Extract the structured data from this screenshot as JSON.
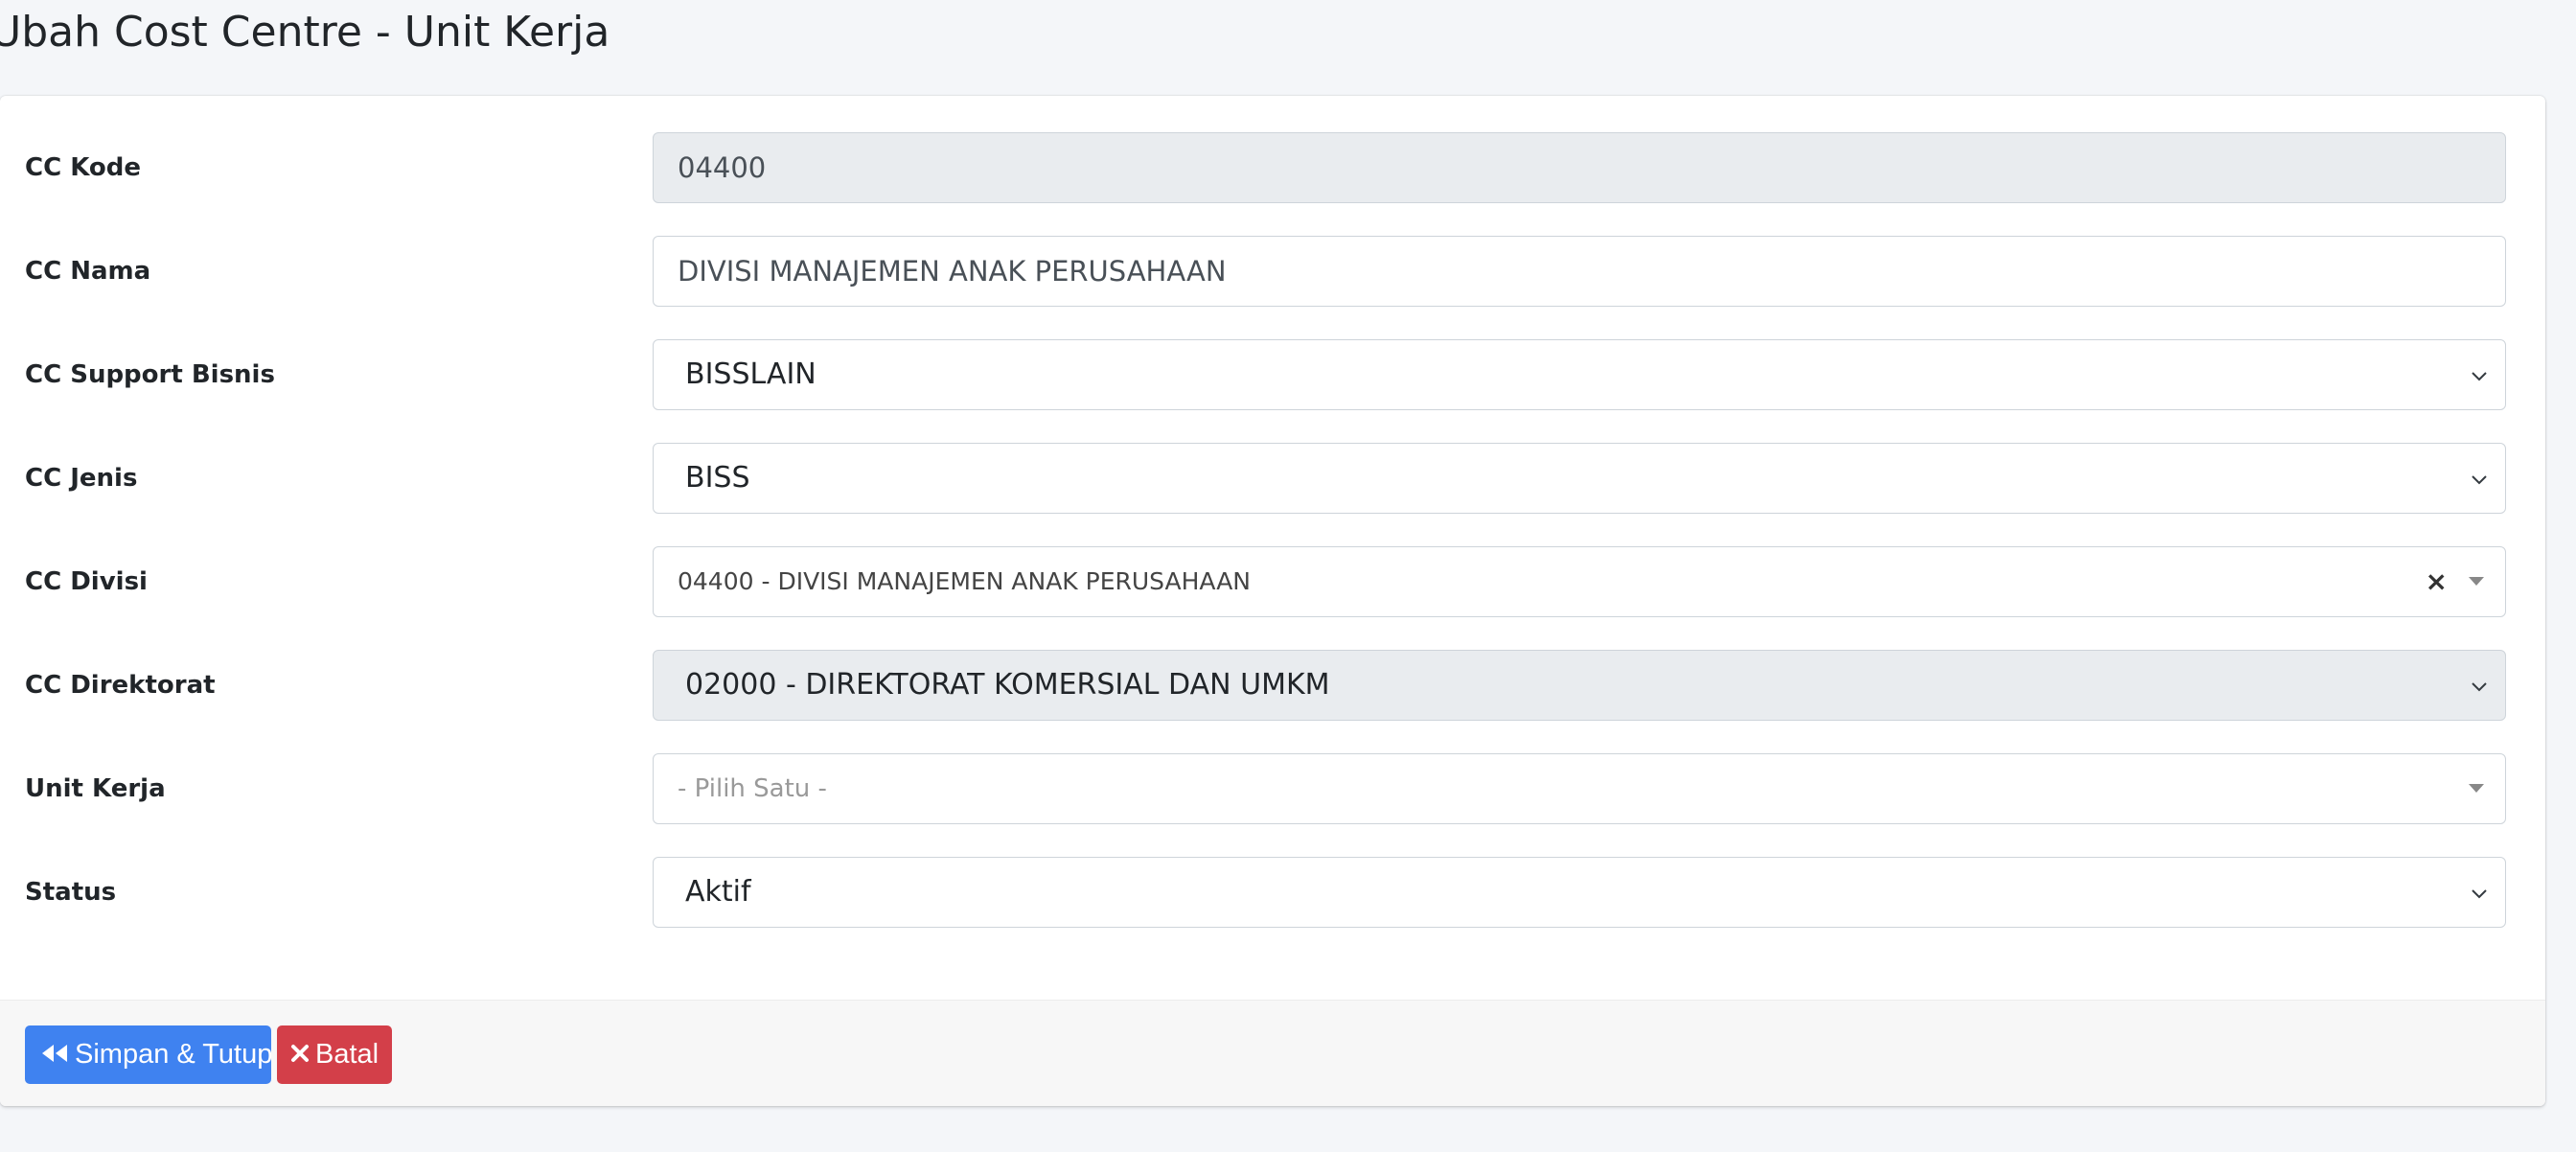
{
  "page": {
    "title": "Ubah Cost Centre - Unit Kerja"
  },
  "form": {
    "cc_kode": {
      "label": "CC Kode",
      "value": "04400"
    },
    "cc_nama": {
      "label": "CC Nama",
      "value": "DIVISI MANAJEMEN ANAK PERUSAHAAN"
    },
    "cc_support_bisnis": {
      "label": "CC Support Bisnis",
      "value": "BISSLAIN"
    },
    "cc_jenis": {
      "label": "CC Jenis",
      "value": "BISS"
    },
    "cc_divisi": {
      "label": "CC Divisi",
      "value": "04400 - DIVISI MANAJEMEN ANAK PERUSAHAAN",
      "clear": "×"
    },
    "cc_direktorat": {
      "label": "CC Direktorat",
      "value": "02000 - DIREKTORAT KOMERSIAL DAN UMKM"
    },
    "unit_kerja": {
      "label": "Unit Kerja",
      "placeholder": "- Pilih Satu -"
    },
    "status": {
      "label": "Status",
      "value": "Aktif"
    }
  },
  "actions": {
    "save_close": "Simpan & Tutup",
    "cancel": "Batal"
  },
  "colors": {
    "primary": "#3f82f0",
    "danger": "#d33f49",
    "readonly_bg": "#e9ecef"
  }
}
